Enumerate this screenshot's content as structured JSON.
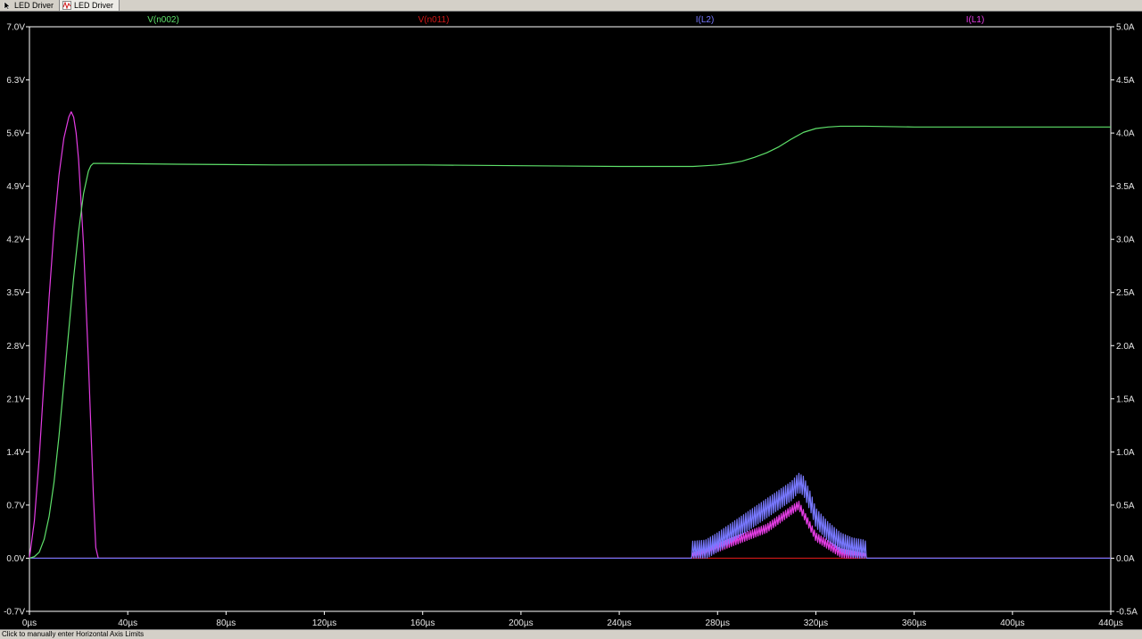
{
  "tabs": [
    {
      "label": "LED Driver",
      "icon": "arrow-cursor-icon",
      "active": false
    },
    {
      "label": "LED Driver",
      "icon": "waveform-icon",
      "active": true
    }
  ],
  "status": {
    "text": "Click to manually enter Horizontal Axis Limits"
  },
  "colors": {
    "background": "#000000",
    "axis": "#ffffff",
    "label": "#e6e6e6",
    "v_n002": "#5ee06a",
    "v_n011": "#d01818",
    "i_l2": "#7878ff",
    "i_l1": "#e43ce4"
  },
  "chart_data": {
    "type": "line",
    "title": "",
    "xlabel": "",
    "ylabel_left": "",
    "ylabel_right": "",
    "x_unit": "µs",
    "xlim": [
      0,
      440
    ],
    "ylim_left": [
      -0.7,
      7.0
    ],
    "ylim_right": [
      -0.5,
      5.0
    ],
    "grid": false,
    "legend": "top",
    "x_ticks": [
      "0µs",
      "40µs",
      "80µs",
      "120µs",
      "160µs",
      "200µs",
      "240µs",
      "280µs",
      "320µs",
      "360µs",
      "400µs",
      "440µs"
    ],
    "y_left_ticks": [
      "-0.7V",
      "0.0V",
      "0.7V",
      "1.4V",
      "2.1V",
      "2.8V",
      "3.5V",
      "4.2V",
      "4.9V",
      "5.6V",
      "6.3V",
      "7.0V"
    ],
    "y_right_ticks": [
      "-0.5A",
      "0.0A",
      "0.5A",
      "1.0A",
      "1.5A",
      "2.0A",
      "2.5A",
      "3.0A",
      "3.5A",
      "4.0A",
      "4.5A",
      "5.0A"
    ],
    "series": [
      {
        "name": "V(n002)",
        "axis": "left",
        "color_key": "v_n002",
        "x": [
          0,
          2,
          4,
          6,
          8,
          10,
          12,
          14,
          16,
          18,
          20,
          22,
          24,
          25,
          26,
          27,
          30,
          60,
          100,
          160,
          200,
          240,
          260,
          270,
          275,
          280,
          285,
          290,
          295,
          300,
          305,
          310,
          315,
          320,
          325,
          330,
          340,
          360,
          400,
          440
        ],
        "y": [
          0.0,
          0.02,
          0.08,
          0.25,
          0.55,
          1.0,
          1.6,
          2.3,
          3.0,
          3.7,
          4.3,
          4.8,
          5.1,
          5.17,
          5.2,
          5.2,
          5.2,
          5.19,
          5.18,
          5.18,
          5.17,
          5.16,
          5.16,
          5.16,
          5.17,
          5.18,
          5.2,
          5.23,
          5.28,
          5.34,
          5.42,
          5.52,
          5.61,
          5.66,
          5.68,
          5.69,
          5.69,
          5.68,
          5.68,
          5.68
        ]
      },
      {
        "name": "V(n011)",
        "axis": "left",
        "color_key": "v_n011",
        "x": [
          0,
          440
        ],
        "y": [
          0.0,
          0.0
        ]
      },
      {
        "name": "I(L2)",
        "axis": "right",
        "color_key": "i_l2",
        "x": [
          0,
          269,
          269.5,
          270,
          275,
          280,
          285,
          290,
          295,
          300,
          305,
          310,
          313,
          315,
          318,
          320,
          325,
          330,
          335,
          340,
          341,
          345,
          400,
          440
        ],
        "y": [
          0,
          0,
          0.07,
          0.07,
          0.08,
          0.15,
          0.23,
          0.31,
          0.39,
          0.47,
          0.55,
          0.63,
          0.71,
          0.68,
          0.52,
          0.38,
          0.25,
          0.15,
          0.1,
          0.08,
          0,
          0,
          0,
          0
        ],
        "ripple": {
          "x_start": 269,
          "x_end": 341,
          "period_us": 0.9,
          "amplitude_a": 0.09
        }
      },
      {
        "name": "I(L1)",
        "axis": "right",
        "color_key": "i_l1",
        "x": [
          0,
          2,
          4,
          6,
          8,
          10,
          12,
          14,
          16,
          17,
          18,
          19,
          20,
          22,
          24,
          26,
          27,
          28,
          269,
          300,
          313,
          320,
          330,
          341,
          345,
          440
        ],
        "y": [
          0,
          0.35,
          0.95,
          1.7,
          2.45,
          3.1,
          3.6,
          3.95,
          4.15,
          4.2,
          4.15,
          4.0,
          3.75,
          2.95,
          1.85,
          0.6,
          0.1,
          0,
          0,
          0.28,
          0.5,
          0.2,
          0.05,
          0,
          0,
          0
        ],
        "ripple": {
          "x_start": 269,
          "x_end": 341,
          "period_us": 0.9,
          "amplitude_a": 0.04
        }
      }
    ]
  }
}
